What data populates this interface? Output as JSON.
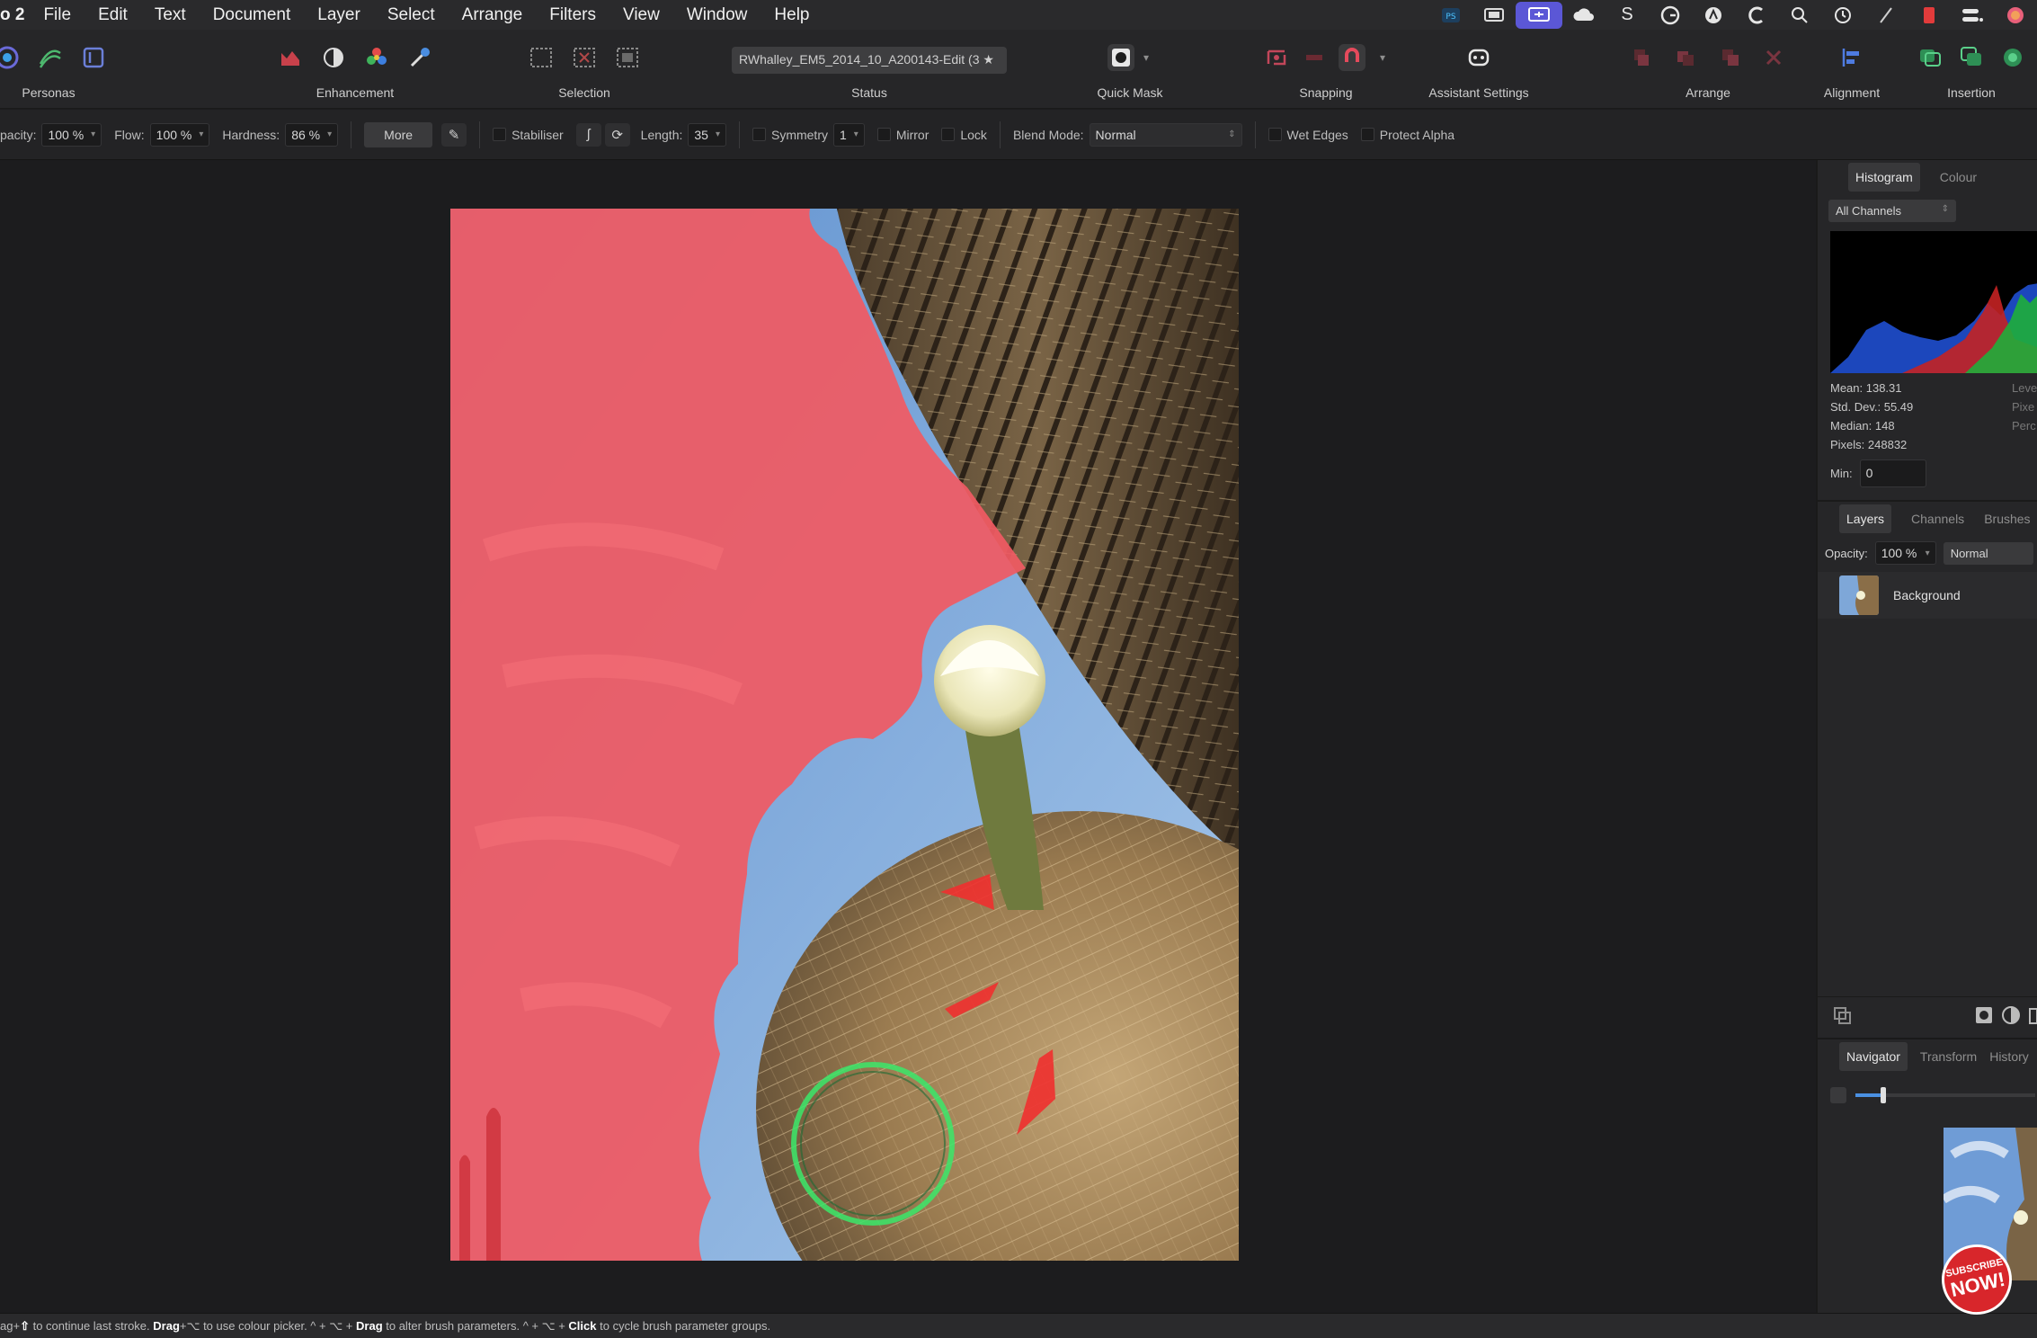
{
  "menubar": {
    "app_name": "o 2",
    "items": [
      "File",
      "Edit",
      "Text",
      "Document",
      "Layer",
      "Select",
      "Arrange",
      "Filters",
      "View",
      "Window",
      "Help"
    ]
  },
  "toolbar": {
    "personas_label": "Personas",
    "enhancement_label": "Enhancement",
    "selection_label": "Selection",
    "status_label": "Status",
    "status_value": "RWhalley_EM5_2014_10_A200143-Edit (3 ★",
    "quickmask_label": "Quick Mask",
    "snapping_label": "Snapping",
    "assistant_label": "Assistant Settings",
    "arrange_label": "Arrange",
    "alignment_label": "Alignment",
    "insertion_label": "Insertion"
  },
  "context": {
    "opacity_label": "pacity:",
    "opacity_value": "100 %",
    "flow_label": "Flow:",
    "flow_value": "100 %",
    "hardness_label": "Hardness:",
    "hardness_value": "86 %",
    "more_label": "More",
    "stabiliser_label": "Stabiliser",
    "length_label": "Length:",
    "length_value": "35",
    "symmetry_label": "Symmetry",
    "symmetry_value": "1",
    "mirror_label": "Mirror",
    "lock_label": "Lock",
    "blendmode_label": "Blend Mode:",
    "blendmode_value": "Normal",
    "wetedges_label": "Wet Edges",
    "protectalpha_label": "Protect Alpha"
  },
  "histogram": {
    "tab_active": "Histogram",
    "tab_other": "Colour",
    "channel_select": "All Channels",
    "mean": "Mean: 138.31",
    "stddev": "Std. Dev.: 55.49",
    "median": "Median: 148",
    "pixels": "Pixels: 248832",
    "min_label": "Min:",
    "min_value": "0",
    "right_labels": [
      "Leve",
      "Pixe",
      "Perc"
    ]
  },
  "layers": {
    "tabs": [
      "Layers",
      "Channels",
      "Brushes"
    ],
    "opacity_label": "Opacity:",
    "opacity_value": "100 %",
    "blend_value": "Normal",
    "layer_name": "Background"
  },
  "navigator": {
    "tabs": [
      "Navigator",
      "Transform",
      "History"
    ]
  },
  "statusbar": {
    "p1": "ag+",
    "k1": "⇧",
    "p2": " to continue last stroke. ",
    "k2": "Drag",
    "p3": "+⌥ to use colour picker. ^ + ⌥ + ",
    "k3": "Drag",
    "p4": " to alter brush parameters. ^ + ⌥ + ",
    "k4": "Click",
    "p5": " to cycle brush parameter groups."
  },
  "badge": {
    "line1": "SUBSCRIBE",
    "line2": "NOW!"
  },
  "colors": {
    "mask_red": "#f05a63",
    "sky_blue": "#6c9fd8",
    "brush_ring": "#3be86a",
    "menubar_active": "#5b57d6"
  }
}
